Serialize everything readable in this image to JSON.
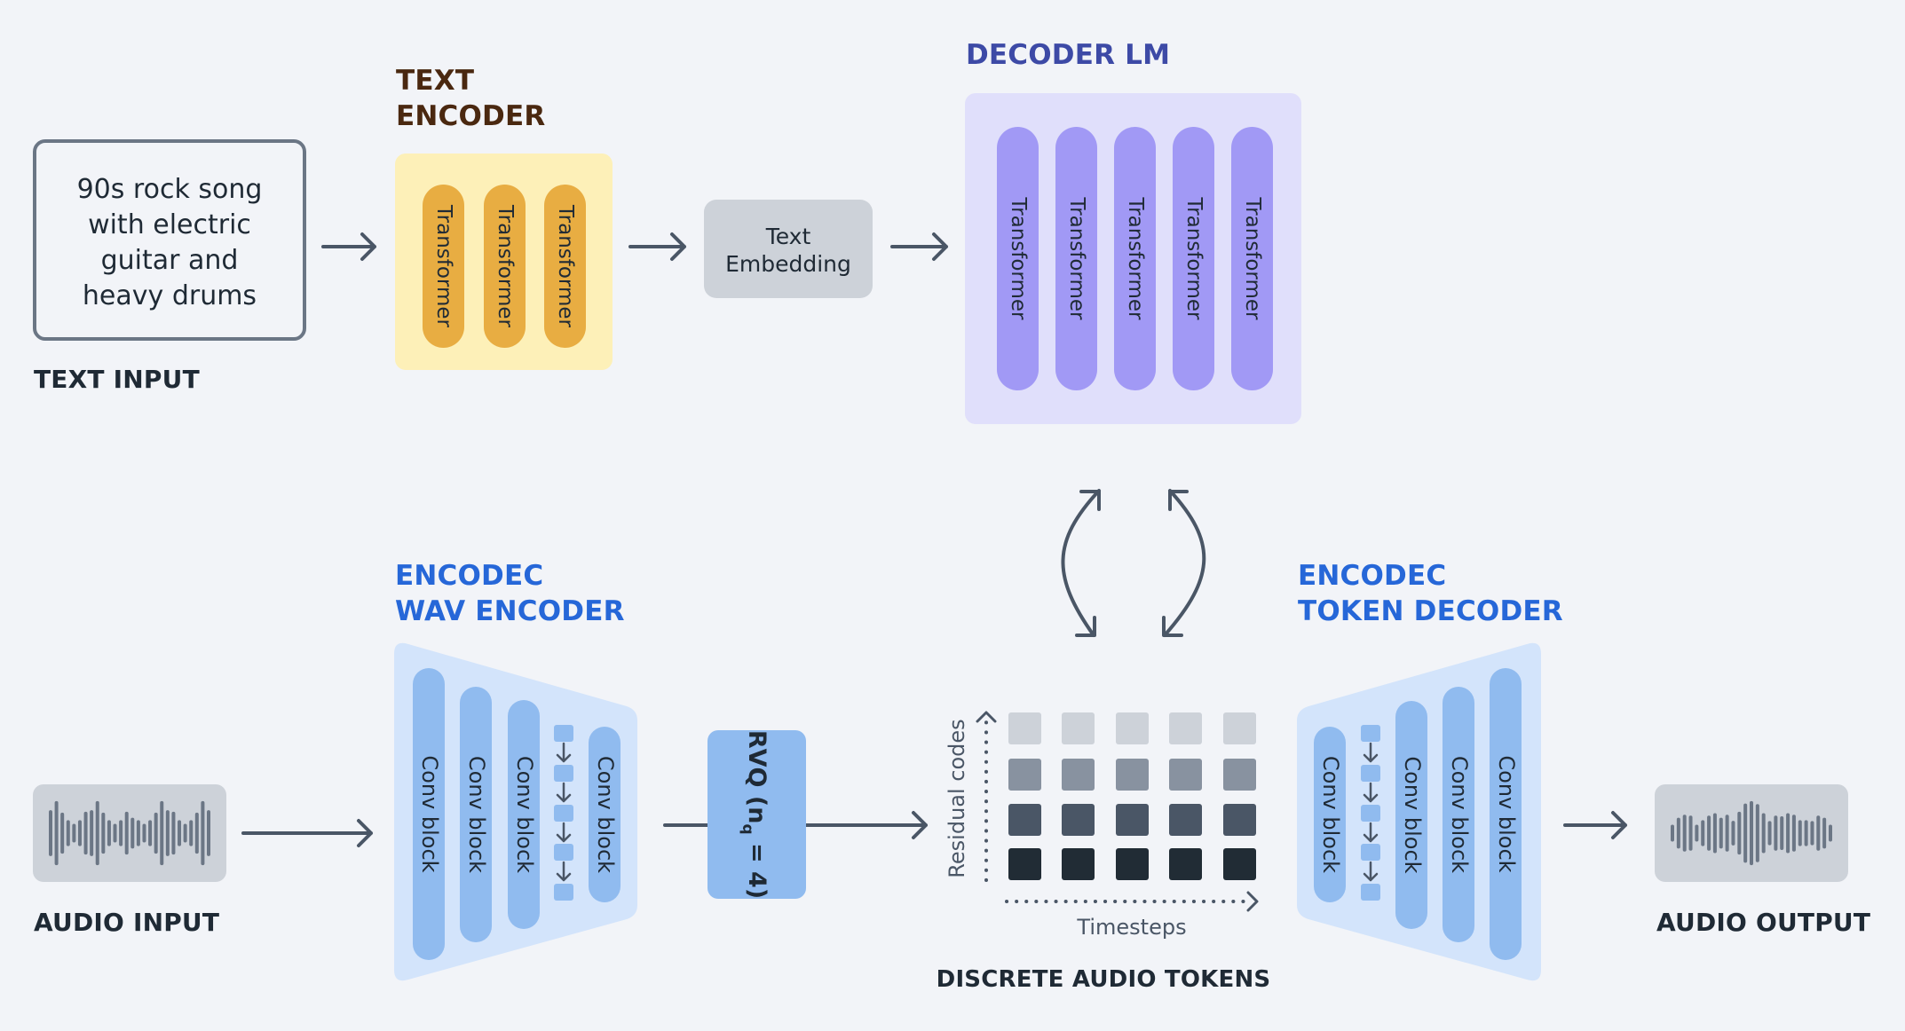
{
  "text_input": {
    "label": "TEXT INPUT",
    "prompt_lines": [
      "90s rock song",
      "with electric",
      "guitar and",
      "heavy drums"
    ]
  },
  "text_encoder": {
    "title_lines": [
      "TEXT",
      "ENCODER"
    ],
    "blocks": [
      "Transformer",
      "Transformer",
      "Transformer"
    ],
    "colors": {
      "panel": "#fdf0b8",
      "block": "#e8ad42",
      "title": "#4a2810"
    }
  },
  "text_embedding": {
    "label_lines": [
      "Text",
      "Embedding"
    ]
  },
  "decoder_lm": {
    "title": "DECODER LM",
    "blocks": [
      "Transformer",
      "Transformer",
      "Transformer",
      "Transformer",
      "Transformer"
    ],
    "colors": {
      "panel": "#e0dffb",
      "block": "#a199f5",
      "title": "#3d4aa6"
    }
  },
  "wav_encoder": {
    "title_lines": [
      "ENCODEC",
      "WAV ENCODER"
    ],
    "blocks": [
      "Conv block",
      "Conv block",
      "Conv block",
      "Conv block"
    ],
    "downsample_steps": 5
  },
  "rvq": {
    "label": "RVQ (n",
    "subscript": "q",
    "label_suffix": " = 4)"
  },
  "tokens": {
    "title": "DISCRETE AUDIO TOKENS",
    "x_axis_label": "Timesteps",
    "y_axis_label": "Residual codes",
    "rows": 4,
    "cols": 5,
    "row_colors": [
      "#cdd2d9",
      "#8892a0",
      "#4a5666",
      "#212c35"
    ]
  },
  "token_decoder": {
    "title_lines": [
      "ENCODEC",
      "TOKEN DECODER"
    ],
    "blocks": [
      "Conv block",
      "Conv block",
      "Conv block",
      "Conv block"
    ],
    "upsample_steps": 5
  },
  "audio_input": {
    "label": "AUDIO INPUT",
    "waveform": [
      0.7,
      1.0,
      0.62,
      0.37,
      0.25,
      0.37,
      0.65,
      0.7,
      1.0,
      0.62,
      0.37,
      0.25,
      0.37,
      0.65,
      0.45,
      0.37,
      0.25,
      0.37,
      0.62,
      1.0,
      0.7,
      0.65,
      0.37,
      0.25,
      0.37,
      0.62,
      1.0,
      0.7
    ]
  },
  "audio_output": {
    "label": "AUDIO OUTPUT",
    "waveform": [
      0.22,
      0.45,
      0.55,
      0.52,
      0.22,
      0.37,
      0.52,
      0.6,
      0.45,
      0.55,
      0.35,
      0.65,
      0.92,
      1.0,
      0.9,
      0.6,
      0.34,
      0.52,
      0.5,
      0.6,
      0.55,
      0.37,
      0.37,
      0.34,
      0.52,
      0.45,
      0.22
    ]
  },
  "colors": {
    "background": "#f2f4f8",
    "arrow": "#4a5666",
    "codec_panel": "#d3e4fb",
    "codec_block": "#90bbef",
    "embedding_box": "#cdd2d9",
    "wave_box": "#cdd2d9",
    "wave_bar": "#6b7685"
  }
}
